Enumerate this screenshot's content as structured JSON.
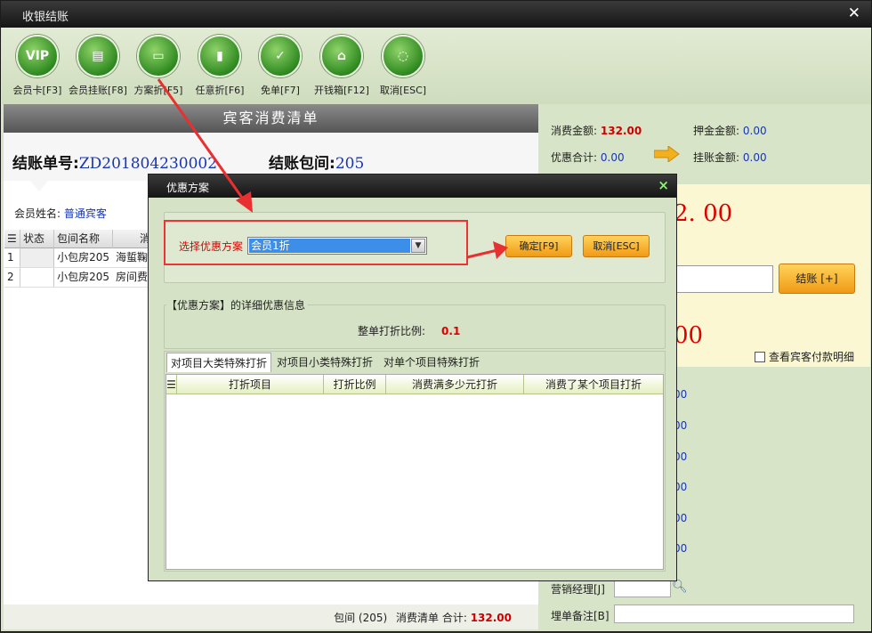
{
  "window": {
    "title": "收银结账",
    "close": "✕"
  },
  "toolbar": [
    {
      "label": "会员卡[F3]",
      "icon": "VIP"
    },
    {
      "label": "会员挂账[F8]",
      "icon": "▤"
    },
    {
      "label": "方案折[F5]",
      "icon": "▭"
    },
    {
      "label": "任意折[F6]",
      "icon": "▮"
    },
    {
      "label": "免单[F7]",
      "icon": "✓"
    },
    {
      "label": "开钱箱[F12]",
      "icon": "⌂"
    },
    {
      "label": "取消[ESC]",
      "icon": "◌"
    }
  ],
  "left": {
    "header": "宾客消费清单",
    "bill_label": "结账单号:",
    "bill_no": "ZD201804230002",
    "room_label": "结账包间:",
    "room_no": "205",
    "member_label": "会员姓名:",
    "member_name": "普通宾客",
    "columns": [
      "状态",
      "包间名称",
      "消"
    ],
    "rows": [
      {
        "idx": "1",
        "status": "",
        "room": "小包房205",
        "item": "海蜇鞠"
      },
      {
        "idx": "2",
        "status": "",
        "room": "小包房205",
        "item": "房间费"
      }
    ],
    "footer": {
      "room": "包间 (205)",
      "list": "消费清单 合计:",
      "total": "132.00"
    }
  },
  "right": {
    "consume_label": "消费金额:",
    "consume": "132.00",
    "deposit_label": "押金金额:",
    "deposit": "0.00",
    "discount_label": "优惠合计:",
    "discount": "0.00",
    "credit_label": "挂账金额:",
    "credit": "0.00",
    "big_amount_1": "2. 00",
    "big_amount_2": "00",
    "checkout_button": "结账 [+]",
    "view_detail": "查看宾客付款明细",
    "side_values": [
      "00",
      "00",
      "00",
      "00",
      "00",
      "00"
    ],
    "manager_label": "营销经理[J]",
    "remark_label": "埋单备注[B]"
  },
  "dialog": {
    "title": "优惠方案",
    "close": "×",
    "select_label": "选择优惠方案",
    "select_value": "会员1折",
    "ok_button": "确定[F9]",
    "cancel_button": "取消[ESC]",
    "detail_group": "【优惠方案】的详细优惠信息",
    "ratio_label": "整单打折比例:",
    "ratio_value": "0.1",
    "tabs": [
      "对项目大类特殊打折",
      "对项目小类特殊打折",
      "对单个项目特殊打折"
    ],
    "table_columns": [
      "打折项目",
      "打折比例",
      "消费满多少元打折",
      "消费了某个项目打折"
    ]
  },
  "colors": {
    "accent_red": "#d00000",
    "value_blue": "#1636b5",
    "button_orange": "#f09a16",
    "annotation": "#e83030"
  }
}
